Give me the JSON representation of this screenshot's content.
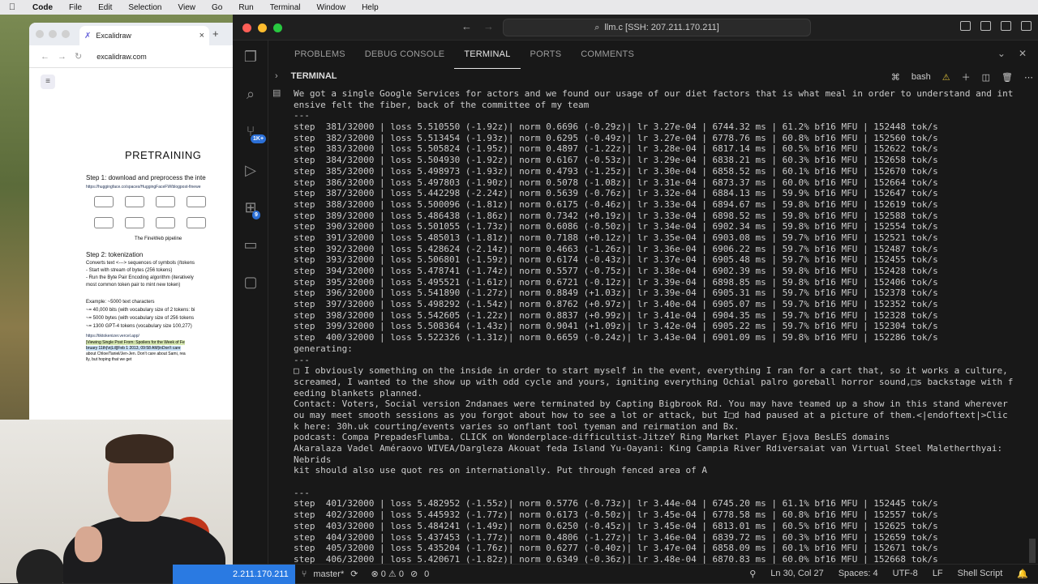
{
  "menubar": {
    "apple": "",
    "items": [
      "Code",
      "File",
      "Edit",
      "Selection",
      "View",
      "Go",
      "Run",
      "Terminal",
      "Window",
      "Help"
    ]
  },
  "browser": {
    "tab_title": "Excalidraw",
    "url": "excalidraw.com",
    "canvas": {
      "title": "PRETRAINING",
      "step1": "Step 1: download and preprocess the inte",
      "step1_link": "https://huggingface.co/spaces/HuggingFaceFW/blogpost-finewe",
      "diagram_caption": "The FineWeb pipeline",
      "step2": "Step 2: tokenization",
      "step2_lines": [
        "Converts text <---> sequences of symbols (/tokens",
        "- Start with stream of bytes (256 tokens)",
        "- Run the Byte Pair Encoding algorithm (iteratively",
        "most common token pair to mint new token)"
      ],
      "example_lines": [
        "Example: ~5000 text characters",
        "~= 40,000 bits (with vocabulary size of 2 tokens: bi",
        "~= 5000 bytes (with vocabulary size of 256 tokens",
        "~= 1300 GPT-4 tokens (vocabulary size 100,277)"
      ],
      "tiktokenizer": "https://tiktokenizer.vercel.app/",
      "token_text": [
        "|Viewing Single Post From: Spoilers for the Week of Fe",
        "bruary 11th|\\n|Lil||Feb 1 2013, 09:58 AM|\\nDon't care ",
        "about Chloe/Taniel/Jen-Jen. Don't care about Sami, rea",
        "lly, but hoping that we get"
      ]
    }
  },
  "vscode": {
    "search_label": "llm.c [SSH: 207.211.170.211]",
    "panel_tabs": [
      "PROBLEMS",
      "DEBUG CONSOLE",
      "TERMINAL",
      "PORTS",
      "COMMENTS"
    ],
    "active_panel_tab": "TERMINAL",
    "terminal_header": "TERMINAL",
    "shell_name": "bash",
    "activity_badges": {
      "source_control": "1K+",
      "extensions": "9"
    },
    "terminal_lines": [
      "We got a single Google Services for actors and we found our usage of our diet factors that is what meal in order to understand and int",
      "ensive felt the fiber, back of the committee of my team",
      "---",
      "step  381/32000 | loss 5.510550 (-1.92z)| norm 0.6696 (-0.29z)| lr 3.27e-04 | 6744.32 ms | 61.2% bf16 MFU | 152448 tok/s",
      "step  382/32000 | loss 5.513454 (-1.93z)| norm 0.6295 (-0.49z)| lr 3.27e-04 | 6778.76 ms | 60.8% bf16 MFU | 152560 tok/s",
      "step  383/32000 | loss 5.505824 (-1.95z)| norm 0.4897 (-1.22z)| lr 3.28e-04 | 6817.14 ms | 60.5% bf16 MFU | 152622 tok/s",
      "step  384/32000 | loss 5.504930 (-1.92z)| norm 0.6167 (-0.53z)| lr 3.29e-04 | 6838.21 ms | 60.3% bf16 MFU | 152658 tok/s",
      "step  385/32000 | loss 5.498973 (-1.93z)| norm 0.4793 (-1.25z)| lr 3.30e-04 | 6858.52 ms | 60.1% bf16 MFU | 152670 tok/s",
      "step  386/32000 | loss 5.497803 (-1.90z)| norm 0.5078 (-1.08z)| lr 3.31e-04 | 6873.37 ms | 60.0% bf16 MFU | 152664 tok/s",
      "step  387/32000 | loss 5.442298 (-2.24z)| norm 0.5639 (-0.76z)| lr 3.32e-04 | 6884.13 ms | 59.9% bf16 MFU | 152647 tok/s",
      "step  388/32000 | loss 5.500096 (-1.81z)| norm 0.6175 (-0.46z)| lr 3.33e-04 | 6894.67 ms | 59.8% bf16 MFU | 152619 tok/s",
      "step  389/32000 | loss 5.486438 (-1.86z)| norm 0.7342 (+0.19z)| lr 3.33e-04 | 6898.52 ms | 59.8% bf16 MFU | 152588 tok/s",
      "step  390/32000 | loss 5.501055 (-1.73z)| norm 0.6086 (-0.50z)| lr 3.34e-04 | 6902.34 ms | 59.8% bf16 MFU | 152554 tok/s",
      "step  391/32000 | loss 5.485013 (-1.81z)| norm 0.7188 (+0.12z)| lr 3.35e-04 | 6903.08 ms | 59.7% bf16 MFU | 152521 tok/s",
      "step  392/32000 | loss 5.428624 (-2.14z)| norm 0.4663 (-1.26z)| lr 3.36e-04 | 6906.22 ms | 59.7% bf16 MFU | 152487 tok/s",
      "step  393/32000 | loss 5.506801 (-1.59z)| norm 0.6174 (-0.43z)| lr 3.37e-04 | 6905.48 ms | 59.7% bf16 MFU | 152455 tok/s",
      "step  394/32000 | loss 5.478741 (-1.74z)| norm 0.5577 (-0.75z)| lr 3.38e-04 | 6902.39 ms | 59.8% bf16 MFU | 152428 tok/s",
      "step  395/32000 | loss 5.495521 (-1.61z)| norm 0.6721 (-0.12z)| lr 3.39e-04 | 6898.85 ms | 59.8% bf16 MFU | 152406 tok/s",
      "step  396/32000 | loss 5.541890 (-1.27z)| norm 0.8849 (+1.03z)| lr 3.39e-04 | 6905.31 ms | 59.7% bf16 MFU | 152378 tok/s",
      "step  397/32000 | loss 5.498292 (-1.54z)| norm 0.8762 (+0.97z)| lr 3.40e-04 | 6905.07 ms | 59.7% bf16 MFU | 152352 tok/s",
      "step  398/32000 | loss 5.542605 (-1.22z)| norm 0.8837 (+0.99z)| lr 3.41e-04 | 6904.35 ms | 59.7% bf16 MFU | 152328 tok/s",
      "step  399/32000 | loss 5.508364 (-1.43z)| norm 0.9041 (+1.09z)| lr 3.42e-04 | 6905.22 ms | 59.7% bf16 MFU | 152304 tok/s",
      "step  400/32000 | loss 5.522326 (-1.31z)| norm 0.6659 (-0.24z)| lr 3.43e-04 | 6901.09 ms | 59.8% bf16 MFU | 152286 tok/s",
      "generating:",
      "---",
      "\u0000 I obviously something on the inside in order to start myself in the event, everything I ran for a cart that, so it works a culture,",
      "screamed, I wanted to the show up with odd cycle and yours, igniting everything Ochial palro goreball horror sound,\u0000s backstage with f",
      "eeding blankets planned.",
      "Contact: Voters, Social version 2ndanaes were terminated by Capting Bigbrook Rd. You may have teamed up a show in this stand wherever",
      "ou may meet smooth sessions as you forgot about how to see a lot or attack, but I\u0000d had paused at a picture of them.<|endoftext|>Clic",
      "k here: 30h.uk courting/events varies so onflant tool tyeman and reirmation and Bx.",
      "podcast: Compa PrepadesFlumba. CLICK on Wonderplace-difficultist-JitzeY Ring Market Player Ejova BesLES domains",
      "Akaralaza Vadel Améraovo WIVEA/Dargleza Akouat feda Island Yu-Oayani: King Campia River Rdiversaiat van Virtual Steel Maletherthyai:",
      "Nebrids",
      "kit should also use quot res on internationally. Put through fenced area of A",
      "",
      "---",
      "step  401/32000 | loss 5.482952 (-1.55z)| norm 0.5776 (-0.73z)| lr 3.44e-04 | 6745.20 ms | 61.1% bf16 MFU | 152445 tok/s",
      "step  402/32000 | loss 5.445932 (-1.77z)| norm 0.6173 (-0.50z)| lr 3.45e-04 | 6778.58 ms | 60.8% bf16 MFU | 152557 tok/s",
      "step  403/32000 | loss 5.484241 (-1.49z)| norm 0.6250 (-0.45z)| lr 3.45e-04 | 6813.01 ms | 60.5% bf16 MFU | 152625 tok/s",
      "step  404/32000 | loss 5.437453 (-1.77z)| norm 0.4806 (-1.27z)| lr 3.46e-04 | 6839.72 ms | 60.3% bf16 MFU | 152659 tok/s",
      "step  405/32000 | loss 5.435204 (-1.76z)| norm 0.6277 (-0.40z)| lr 3.47e-04 | 6858.09 ms | 60.1% bf16 MFU | 152671 tok/s",
      "step  406/32000 | loss 5.420671 (-1.82z)| norm 0.6349 (-0.36z)| lr 3.48e-04 | 6870.83 ms | 60.0% bf16 MFU | 152668 tok/s"
    ],
    "statusbar": {
      "remote": "2.211.170.211",
      "branch": "master*",
      "problems": "⊗ 0 ⚠ 0",
      "ports": "0",
      "position": "Ln 30, Col 27",
      "spaces": "Spaces: 4",
      "encoding": "UTF-8",
      "eol": "LF",
      "language": "Shell Script"
    }
  },
  "colors": {
    "accent": "#2a7ae2",
    "terminal_bg": "#181818",
    "terminal_fg": "#cccccc"
  }
}
